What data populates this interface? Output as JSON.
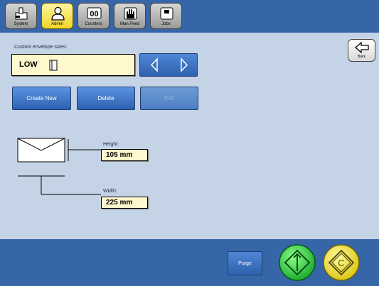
{
  "tabs": [
    {
      "label": "System",
      "icon": "system-icon",
      "active": false
    },
    {
      "label": "Admin",
      "icon": "admin-user-icon",
      "active": true
    },
    {
      "label": "Counters",
      "icon": "counters-icon",
      "active": false
    },
    {
      "label": "Man.Feed",
      "icon": "hand-icon",
      "active": false
    },
    {
      "label": "Jobs",
      "icon": "jobs-icon",
      "active": false
    }
  ],
  "panel": {
    "title": "Custom envelope sizes:",
    "selected_size": "LOW"
  },
  "actions": {
    "create_new": "Create New",
    "delete": "Delete",
    "edit": "Edit"
  },
  "back": {
    "label": "Back"
  },
  "dimensions": {
    "height_label": "Height:",
    "height_value": "105 mm",
    "width_label": "Width:",
    "width_value": "225 mm"
  },
  "bottom": {
    "purge": "Purge",
    "start_icon": "start-green-icon",
    "stop_icon": "stop-yellow-icon"
  },
  "colors": {
    "bar": "#3666a8",
    "background": "#c5d3e6",
    "field": "#fff8cc",
    "active_tab": "#f1d52a",
    "start": "#22c23a",
    "stop": "#f2e320"
  }
}
